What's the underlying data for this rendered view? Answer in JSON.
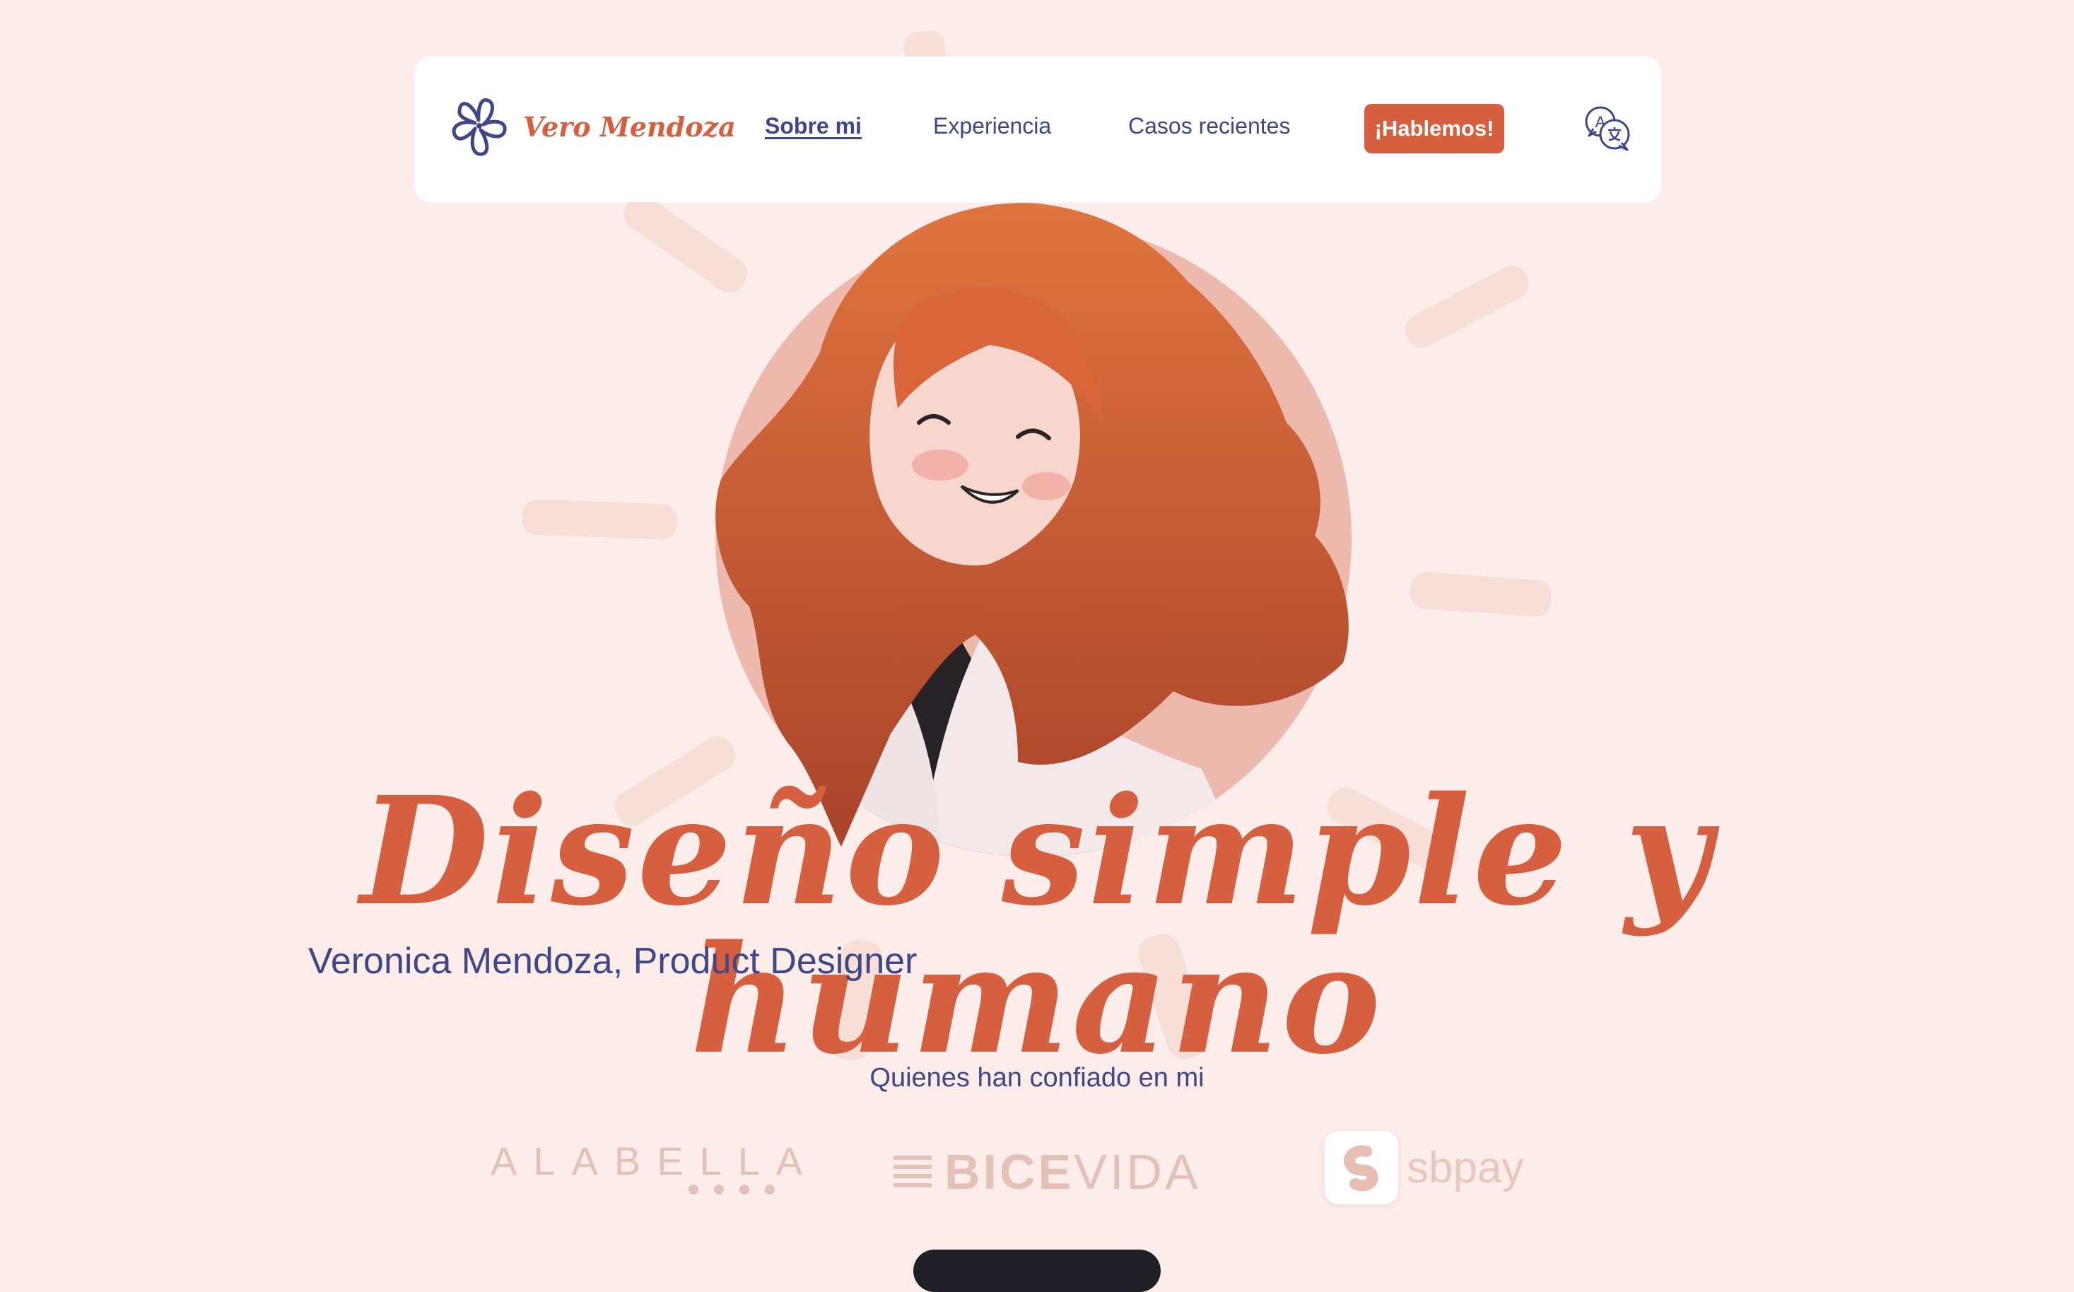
{
  "nav": {
    "brand": "Vero Mendoza",
    "links": [
      "Sobre mi",
      "Experiencia",
      "Casos recientes"
    ],
    "active_link": "Sobre mi",
    "cta": "¡Hablemos!",
    "language_icon": "translate-icon",
    "logo_icon": "flower-icon"
  },
  "hero": {
    "headline": "Diseño simple y humano",
    "subtitle": "Veronica Mendoza, Product Designer",
    "portrait": "illustrated-portrait"
  },
  "clients": {
    "heading": "Quienes han confiado en mi",
    "logos": [
      "ALABELLA",
      "BICE",
      "VIDA",
      "sbpay"
    ]
  },
  "colors": {
    "background": "#fcedeb",
    "accent": "#d65f3f",
    "navy": "#3f4787",
    "muted_logo": "#e3c1b6"
  }
}
